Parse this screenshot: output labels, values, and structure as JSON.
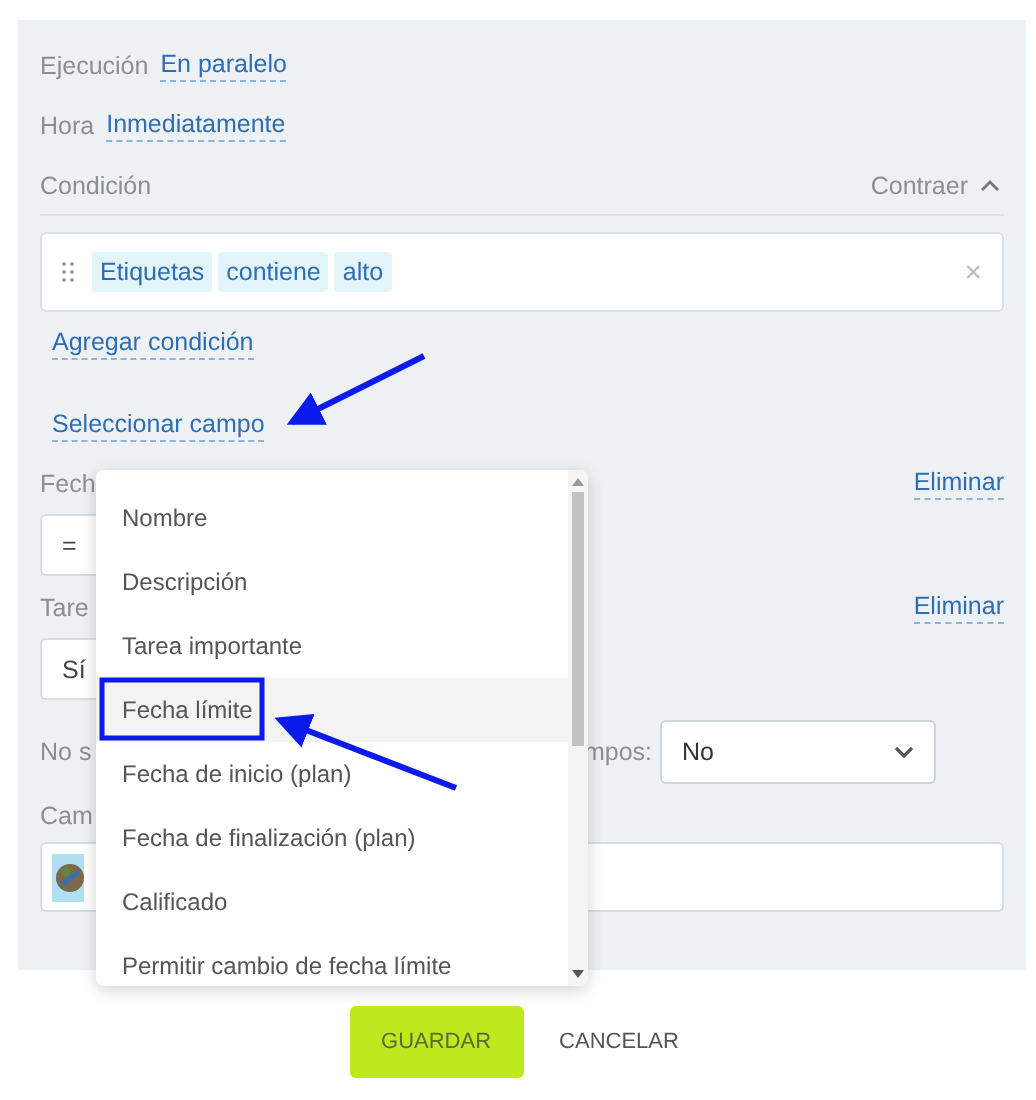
{
  "settings": [
    {
      "label": "Ejecución",
      "value": "En paralelo"
    },
    {
      "label": "Hora",
      "value": "Inmediatamente"
    }
  ],
  "condition": {
    "title": "Condición",
    "collapse": "Contraer",
    "expanded": true,
    "tokens": [
      "Etiquetas",
      "contiene",
      "alto"
    ],
    "remove": "×",
    "add_link": "Agregar condición"
  },
  "select_field_link": "Seleccionar campo",
  "fields": [
    {
      "kind": "input",
      "label": "Fech",
      "value": "=",
      "remove": "Eliminar"
    },
    {
      "kind": "input",
      "label": "Tare",
      "value": "Sí",
      "remove": "Eliminar"
    },
    {
      "kind": "select",
      "label": "No s",
      "label_tail": "mpos:",
      "value": "No"
    },
    {
      "kind": "avatar",
      "label": "Cam"
    }
  ],
  "dropdown": {
    "items": [
      {
        "label": "Nombre",
        "highlighted": false
      },
      {
        "label": "Descripción",
        "highlighted": false
      },
      {
        "label": "Tarea importante",
        "highlighted": false
      },
      {
        "label": "Fecha límite",
        "highlighted": true
      },
      {
        "label": "Fecha de inicio (plan)",
        "highlighted": false
      },
      {
        "label": "Fecha de finalización (plan)",
        "highlighted": false
      },
      {
        "label": "Calificado",
        "highlighted": false
      },
      {
        "label": "Permitir cambio de fecha límite",
        "highlighted": false
      }
    ]
  },
  "buttons": {
    "save": "GUARDAR",
    "cancel": "CANCELAR"
  }
}
